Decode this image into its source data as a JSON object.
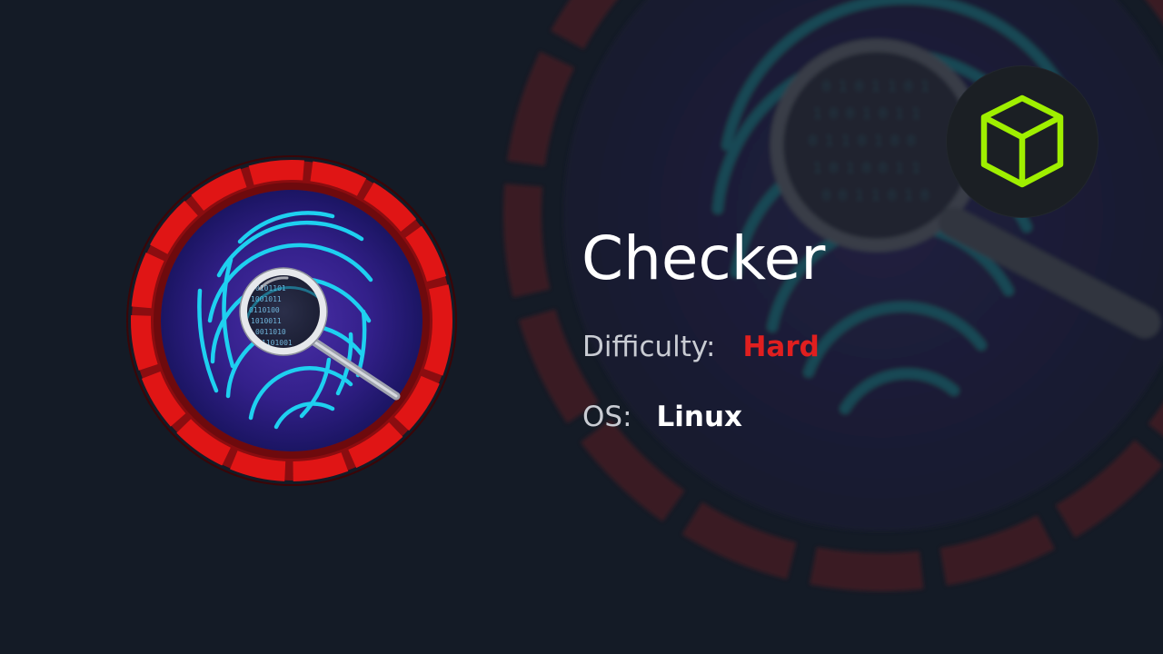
{
  "machine": {
    "name": "Checker",
    "difficulty_label": "Difficulty:",
    "difficulty_value": "Hard",
    "os_label": "OS:",
    "os_value": "Linux"
  },
  "badge": {
    "icon": "fingerprint-magnifier-icon",
    "binary_rows": [
      "0101101",
      "1001011",
      "0110100",
      "1010011",
      "0011010",
      "1101001"
    ]
  },
  "logo": {
    "icon": "cube-icon"
  },
  "colors": {
    "background": "#141b26",
    "title": "#ffffff",
    "label": "#c9ccd3",
    "difficulty_hard": "#e01f1f",
    "badge_ring": "#e01515",
    "fingerprint": "#1ed0f0",
    "logo_green": "#9fef00"
  }
}
